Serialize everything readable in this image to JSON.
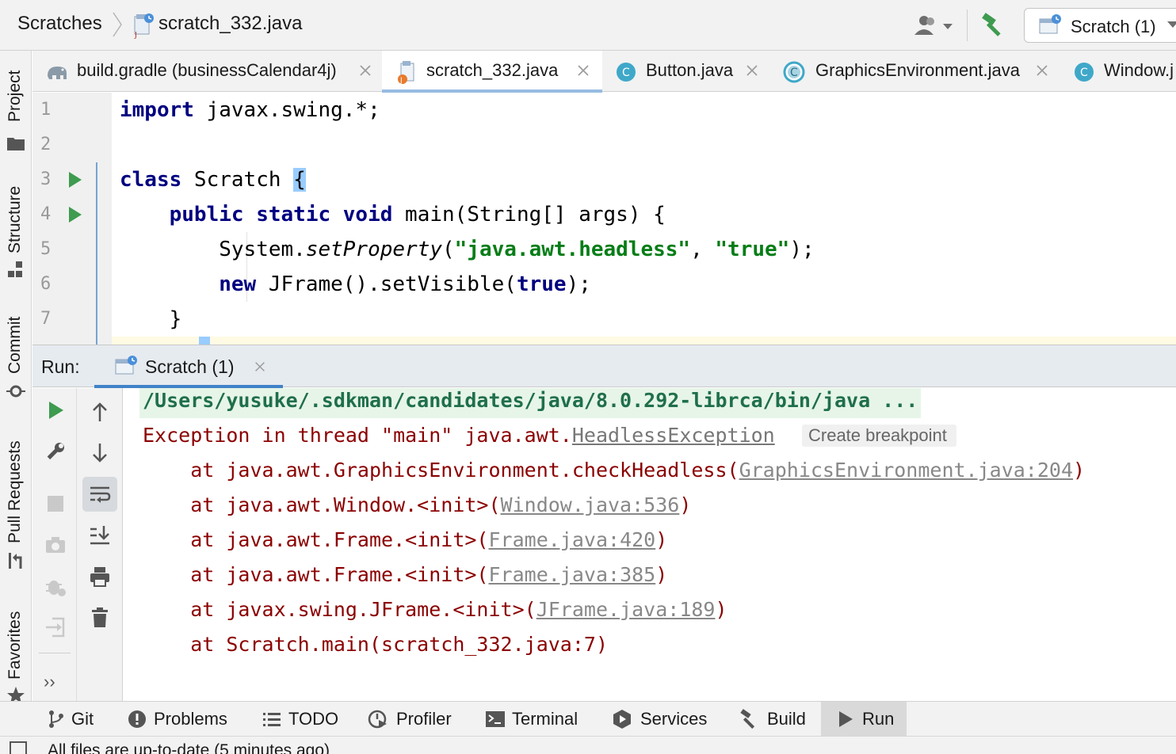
{
  "navbar": {
    "breadcrumb_root": "Scratches",
    "breadcrumb_file": "scratch_332.java",
    "run_config_label": "Scratch (1)"
  },
  "left_strip": {
    "project": "Project",
    "structure": "Structure",
    "commit": "Commit",
    "pull_requests": "Pull Requests",
    "favorites": "Favorites"
  },
  "editor_tabs": [
    {
      "label": "build.gradle (businessCalendar4j)",
      "icon": "gradle-elephant-icon"
    },
    {
      "label": "scratch_332.java",
      "icon": "java-scratch-icon",
      "active": true
    },
    {
      "label": "Button.java",
      "icon": "java-class-icon"
    },
    {
      "label": "GraphicsEnvironment.java",
      "icon": "java-abstract-class-icon"
    },
    {
      "label": "Window.j",
      "icon": "java-class-icon"
    }
  ],
  "code_lines": {
    "l1": {
      "num": "1",
      "kw": "import",
      "rest": " javax.swing.*;"
    },
    "l2": {
      "num": "2"
    },
    "l3": {
      "num": "3",
      "kw": "class",
      "rest": " Scratch ",
      "brace": "{"
    },
    "l4": {
      "num": "4",
      "indent": "    ",
      "kw1": "public",
      "kw2": "static",
      "kw3": "void",
      "rest": " main(String[] args) {"
    },
    "l5": {
      "num": "5",
      "indent": "        ",
      "obj": "System.",
      "method": "setProperty",
      "open": "(",
      "s1": "\"java.awt.headless\"",
      "comma": ", ",
      "s2": "\"true\"",
      "close": ");"
    },
    "l6": {
      "num": "6",
      "indent": "        ",
      "kw": "new",
      "mid": " JFrame().setVisible(",
      "kw2": "true",
      "close": ");"
    },
    "l7": {
      "num": "7",
      "text": "    }"
    }
  },
  "run": {
    "title": "Run:",
    "tab_label": "Scratch (1)"
  },
  "console": {
    "cmd": "/Users/yusuke/.sdkman/candidates/java/8.0.292-librca/bin/java ...",
    "exception_prefix": "Exception in thread \"main\" java.awt.",
    "exception_class": "HeadlessException",
    "create_breakpoint": "Create breakpoint",
    "trace": [
      {
        "prefix": "    at java.awt.GraphicsEnvironment.checkHeadless(",
        "link": "GraphicsEnvironment.java:204",
        "suffix": ")"
      },
      {
        "prefix": "    at java.awt.Window.<init>(",
        "link": "Window.java:536",
        "suffix": ")"
      },
      {
        "prefix": "    at java.awt.Frame.<init>(",
        "link": "Frame.java:420",
        "suffix": ")"
      },
      {
        "prefix": "    at java.awt.Frame.<init>(",
        "link": "Frame.java:385",
        "suffix": ")"
      },
      {
        "prefix": "    at javax.swing.JFrame.<init>(",
        "link": "JFrame.java:189",
        "suffix": ")"
      },
      {
        "prefix": "    at Scratch.main(scratch_332.java:7)",
        "link": "",
        "suffix": ""
      }
    ]
  },
  "bottom_bar": {
    "git": "Git",
    "problems": "Problems",
    "todo": "TODO",
    "profiler": "Profiler",
    "terminal": "Terminal",
    "services": "Services",
    "build": "Build",
    "run": "Run"
  },
  "status": {
    "text": "All files are up-to-date (5 minutes ago)"
  },
  "colors": {
    "keyword": "#000080",
    "string": "#067d17",
    "error_text": "#8b0000",
    "run_green": "#3e9b4f",
    "accent": "#4083c9"
  }
}
